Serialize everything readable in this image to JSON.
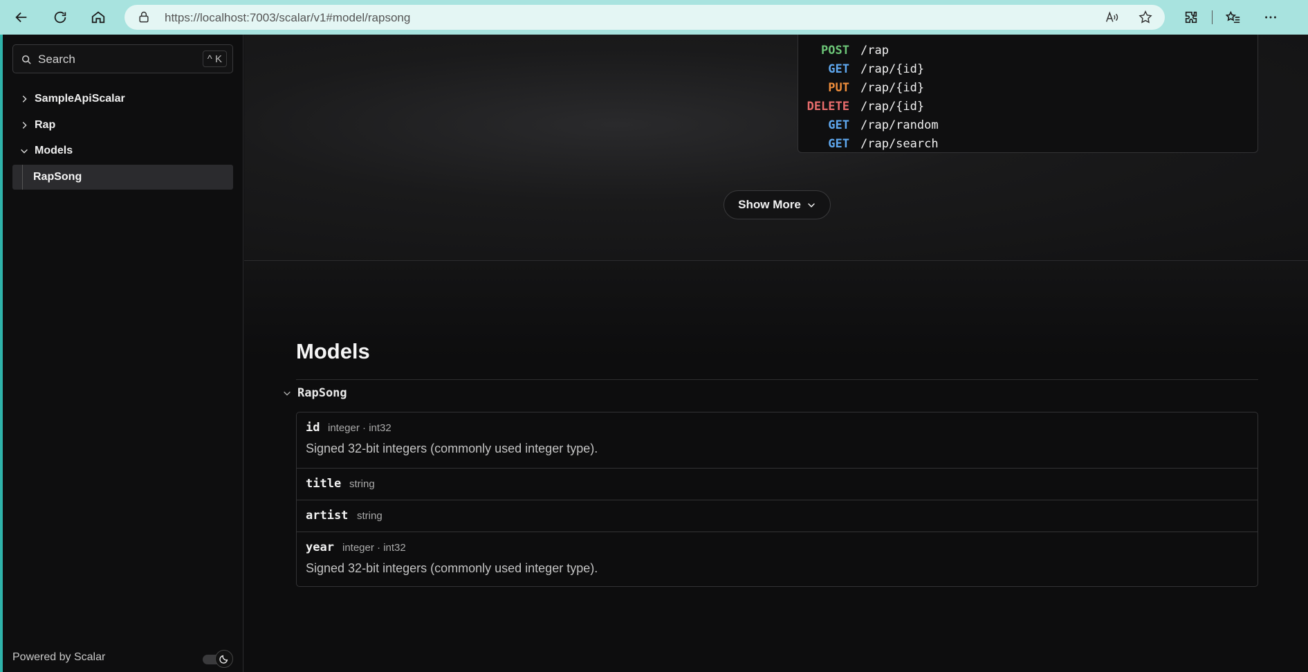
{
  "browser": {
    "url_host": "https://localhost",
    "url_rest": ":7003/scalar/v1#model/rapsong"
  },
  "sidebar": {
    "search_label": "Search",
    "search_shortcut": "^ K",
    "items": [
      {
        "label": "SampleApiScalar"
      },
      {
        "label": "Rap"
      },
      {
        "label": "Models"
      },
      {
        "label": "RapSong"
      }
    ],
    "footer": "Powered by Scalar"
  },
  "endpoints": [
    {
      "method": "POST",
      "path": "/rap"
    },
    {
      "method": "GET",
      "path": "/rap/{id}"
    },
    {
      "method": "PUT",
      "path": "/rap/{id}"
    },
    {
      "method": "DELETE",
      "path": "/rap/{id}"
    },
    {
      "method": "GET",
      "path": "/rap/random"
    },
    {
      "method": "GET",
      "path": "/rap/search"
    }
  ],
  "show_more_label": "Show More",
  "models": {
    "title": "Models",
    "model_name": "RapSong",
    "properties": [
      {
        "name": "id",
        "type": "integer · int32",
        "description": "Signed 32-bit integers (commonly used integer type)."
      },
      {
        "name": "title",
        "type": "string",
        "description": ""
      },
      {
        "name": "artist",
        "type": "string",
        "description": ""
      },
      {
        "name": "year",
        "type": "integer · int32",
        "description": "Signed 32-bit integers (commonly used integer type)."
      }
    ]
  },
  "colors": {
    "chrome": "#a8e3df",
    "post": "#6cc577",
    "get": "#5fa8ef",
    "put": "#ef8d3b",
    "delete": "#ea6d6d"
  }
}
